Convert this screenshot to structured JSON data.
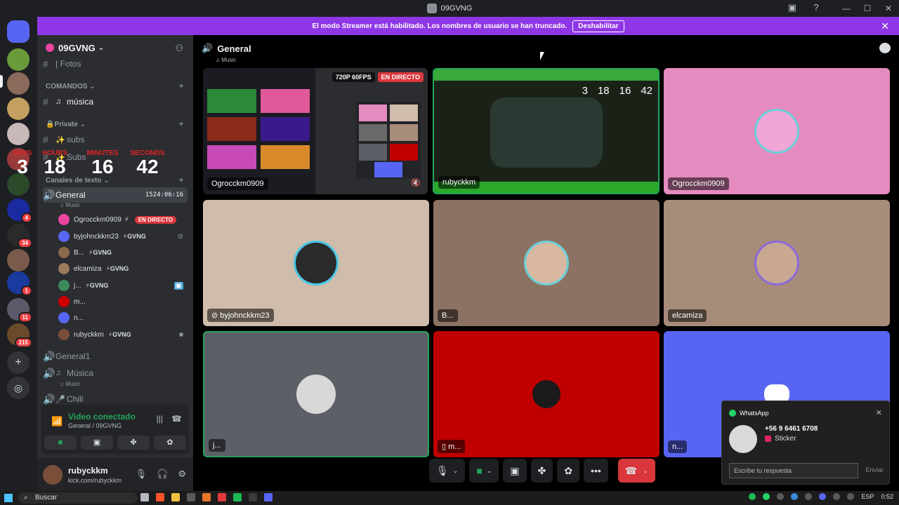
{
  "window": {
    "title": "09GVNG",
    "controls": [
      "—",
      "☐",
      "✕"
    ]
  },
  "banner": {
    "text": "El modo Streamer está habilitado. Los nombres de usuario se han truncado.",
    "button": "Deshabilitar"
  },
  "servers": {
    "badges": [
      "4",
      "34",
      "1",
      "11",
      "215"
    ]
  },
  "sidebar": {
    "server_name": "09GVNG",
    "fotos": "| Fotos",
    "cat_comandos": "COMANDOS",
    "musica": "música",
    "cat_private": "Private",
    "subs": "subs",
    "subs2": "Subs",
    "cat_texto": "Canales de texto",
    "general": "General",
    "general_time": "1524:06:16",
    "general_sub": "Music",
    "general1": "General",
    "musica2": "Música",
    "musica2_sub": "Music",
    "chill": "Chill",
    "timer": {
      "labels": [
        "DAYS",
        "HOURS",
        "MINUTES",
        "SECONDS"
      ],
      "values": [
        "3",
        "18",
        "16",
        "42"
      ]
    },
    "voice_users": [
      {
        "name": "Ogrocckm0909",
        "tag": "",
        "live": "EN DIRECTO",
        "color": "#eb459e"
      },
      {
        "name": "byjohnckkm23",
        "tag": "GVNG",
        "live": "",
        "color": "#5865f2"
      },
      {
        "name": "B...",
        "tag": "GVNG",
        "live": "",
        "color": "#8a6a4a"
      },
      {
        "name": "elcamiza",
        "tag": "GVNG",
        "live": "",
        "color": "#9a7a5a"
      },
      {
        "name": "j...",
        "tag": "GVNG",
        "live": "",
        "color": "#3a8a5a"
      },
      {
        "name": "m...",
        "tag": "",
        "live": "",
        "color": "#cc0000"
      },
      {
        "name": "n...",
        "tag": "",
        "live": "",
        "color": "#5865f2"
      },
      {
        "name": "rubyckkm",
        "tag": "GVNG",
        "live": "",
        "color": "#7a4f3a"
      }
    ]
  },
  "voice_panel": {
    "title": "Video conectado",
    "subtitle": "General / 09GVNG"
  },
  "user_panel": {
    "name": "rubyckkm",
    "status": "kick.com/rubyckkm"
  },
  "main": {
    "channel": "General",
    "channel_sub": "Music",
    "stream_tags": [
      "720P 60FPS",
      "EN DIRECTO"
    ],
    "tiles": [
      {
        "label": "Ogrocckm0909",
        "bg": "#2b2d31"
      },
      {
        "label": "rubyckkm",
        "bg": "#1a2218"
      },
      {
        "label": "Ogrocckm0909",
        "bg": "#e58bbf"
      },
      {
        "label": "byjohnckkm23",
        "bg": "#cfbcaa"
      },
      {
        "label": "B...",
        "bg": "#8c7262"
      },
      {
        "label": "elcamiza",
        "bg": "#a88c7a"
      },
      {
        "label": "j...",
        "bg": "#5c5f66"
      },
      {
        "label": "m...",
        "bg": "#c00000"
      },
      {
        "label": "n...",
        "bg": "#5865f2"
      }
    ],
    "video_time": {
      "values": [
        "3",
        "18",
        "16",
        "42"
      ]
    }
  },
  "toast": {
    "app": "WhatsApp",
    "number": "+56 9 6461 6708",
    "message": "Sticker",
    "input_placeholder": "Escribe tu respuesta",
    "send": "Enviar"
  },
  "taskbar": {
    "search": "Buscar",
    "lang": "ESP",
    "time": "0:52"
  }
}
